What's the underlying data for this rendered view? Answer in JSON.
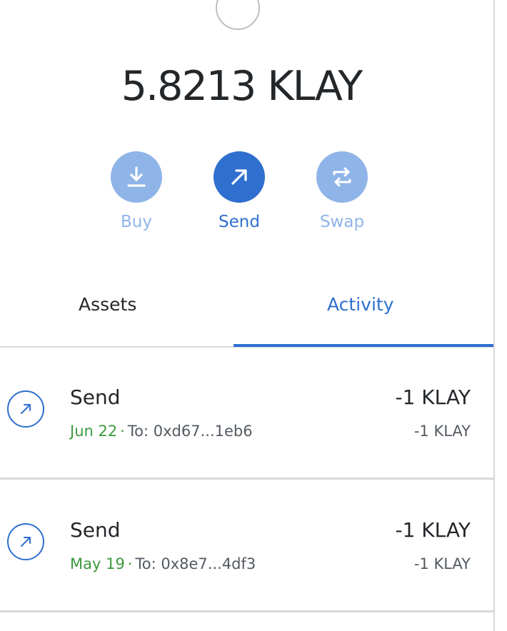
{
  "balance": {
    "amount": "5.8213",
    "unit": "KLAY"
  },
  "actions": [
    {
      "label": "Buy",
      "icon": "download-icon"
    },
    {
      "label": "Send",
      "icon": "arrow-up-right-icon"
    },
    {
      "label": "Swap",
      "icon": "swap-arrows-icon"
    }
  ],
  "tabs": [
    {
      "label": "Assets",
      "active": false
    },
    {
      "label": "Activity",
      "active": true
    }
  ],
  "transactions": [
    {
      "type": "Send",
      "date": "Jun 22",
      "separator": "·",
      "to": "To: 0xd67...1eb6",
      "amount": "-1 KLAY",
      "fiat": "-1 KLAY"
    },
    {
      "type": "Send",
      "date": "May 19",
      "separator": "·",
      "to": "To: 0x8e7...4df3",
      "amount": "-1 KLAY",
      "fiat": "-1 KLAY"
    }
  ],
  "colors": {
    "primary": "#2f6fcf",
    "primary_muted": "#8fb4e8",
    "date_green": "#3e9a3e",
    "divider": "#d6d9dc",
    "text": "#24272a"
  }
}
